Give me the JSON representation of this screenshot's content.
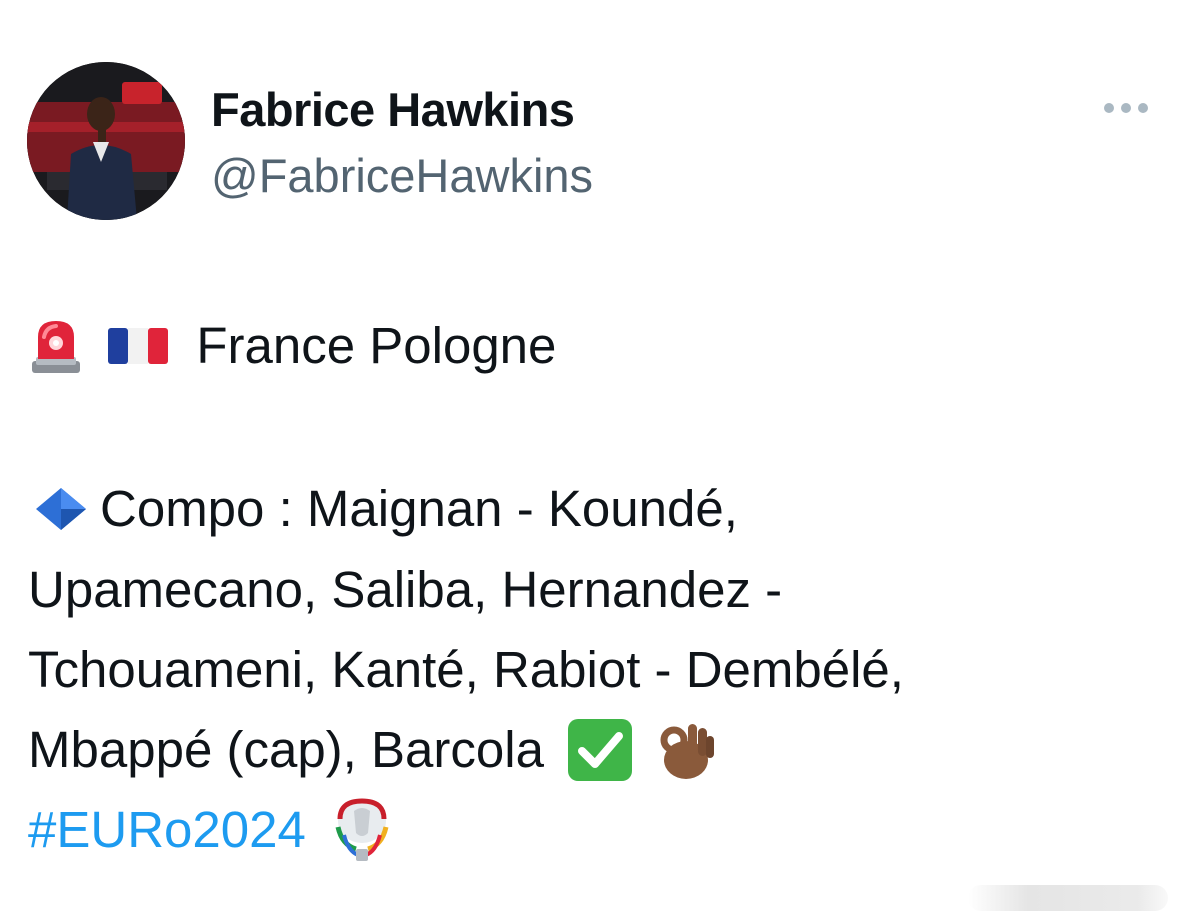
{
  "author": {
    "name": "Fabrice Hawkins",
    "handle": "@FabriceHawkins",
    "avatar_icon": "profile-photo"
  },
  "tweet": {
    "title_text": "France Pologne",
    "title_icons": [
      "rotating-light-icon",
      "france-flag-icon"
    ],
    "compo_icon": "blue-diamond-icon",
    "lines": [
      "Compo : Maignan - Koundé,",
      "Upamecano, Saliba, Hernandez -",
      "Tchouameni, Kanté, Rabiot - Dembélé,",
      "Mbappé (cap), Barcola"
    ],
    "end_icons": [
      "check-mark-button-icon",
      "ok-hand-icon"
    ],
    "hashtag": "#EURo2024",
    "hashtag_icon": "euro-trophy-icon"
  },
  "colors": {
    "text": "#0f1419",
    "secondary": "#536471",
    "link": "#1d9bf0"
  },
  "menu": {
    "more_icon": "more-dots-icon"
  }
}
